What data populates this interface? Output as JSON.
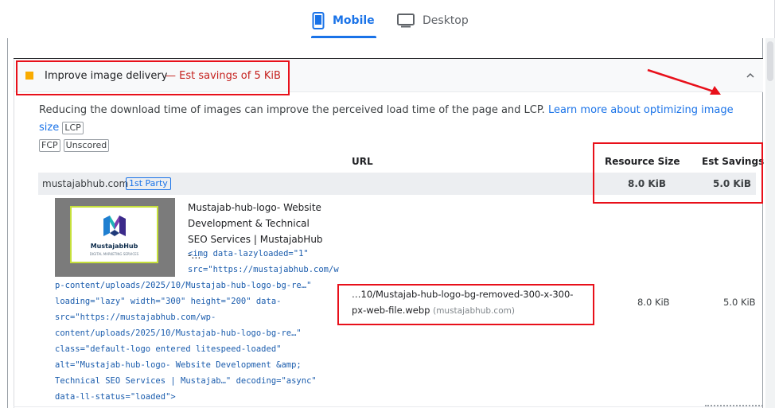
{
  "tabs": {
    "mobile_label": "Mobile",
    "desktop_label": "Desktop",
    "active": "mobile",
    "accent_color": "#1a73e8"
  },
  "audit": {
    "title": "Improve image delivery",
    "savings": "— Est savings of 5 KiB",
    "severity_color": "#f9ab00",
    "description": "Reducing the download time of images can improve the perceived load time of the page and LCP.",
    "learn_more": "Learn more about optimizing image size",
    "chips": [
      "LCP",
      "FCP",
      "Unscored"
    ]
  },
  "table": {
    "headers": {
      "url": "URL",
      "resource_size": "Resource Size",
      "est_savings": "Est Savings"
    },
    "party": {
      "name": "mustajabhub.com",
      "badge": "1st Party",
      "resource_size": "8.0 KiB",
      "est_savings": "5.0 KiB"
    },
    "rows": [
      {
        "thumbnail": {
          "logo_text": "MustajabHub",
          "logo_sub": "DIGITAL MARKETING SERVICES"
        },
        "element_title": "Mustajab-hub-logo- Website Development & Technical SEO Services | MustajabHub -…",
        "snippet_a": "<img data-lazyloaded=\"1\"\nsrc=\"https://mustajabhub.com/w",
        "snippet_b": "p-content/uploads/2025/10/Mustajab-hub-logo-bg-re…\"\nloading=\"lazy\" width=\"300\" height=\"200\" data-\nsrc=\"https://mustajabhub.com/wp-\ncontent/uploads/2025/10/Mustajab-hub-logo-bg-re…\"\nclass=\"default-logo entered litespeed-loaded\"\nalt=\"Mustajab-hub-logo- Website Development &amp;\nTechnical SEO Services | Mustajab…\" decoding=\"async\"\ndata-ll-status=\"loaded\">",
        "url": "…10/Mustajab-hub-logo-bg-removed-300-x-300-px-web-file.webp",
        "url_host": "(mustajabhub.com)",
        "resource_size": "8.0 KiB",
        "est_savings": "5.0 KiB"
      }
    ]
  },
  "annotation_color": "#e8101a"
}
